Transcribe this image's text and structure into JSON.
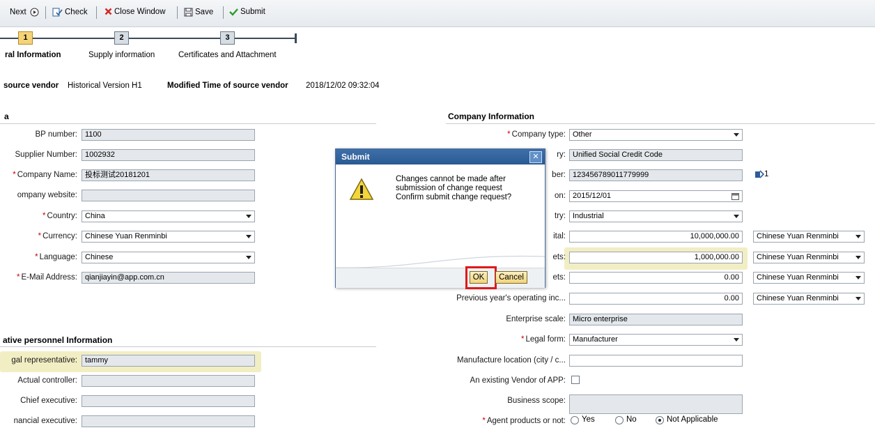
{
  "toolbar": {
    "next": "Next",
    "check": "Check",
    "close_window": "Close Window",
    "save": "Save",
    "submit": "Submit"
  },
  "steps": [
    {
      "num": "1",
      "label": "ral Information"
    },
    {
      "num": "2",
      "label": "Supply information"
    },
    {
      "num": "3",
      "label": "Certificates and Attachment"
    }
  ],
  "source_info": {
    "source_vendor_label": "source vendor",
    "source_vendor_value": "Historical Version H1",
    "modified_time_label": "Modified Time of source vendor",
    "modified_time_value": "2018/12/02 09:32:04"
  },
  "left_section": {
    "header": "a",
    "fields": [
      {
        "label": "BP number:",
        "value": "1100",
        "required": false
      },
      {
        "label": "Supplier Number:",
        "value": "1002932",
        "required": false
      },
      {
        "label": "Company Name:",
        "value": "投标测试20181201",
        "required": true
      },
      {
        "label": "ompany website:",
        "value": "",
        "required": false
      },
      {
        "label": "Country:",
        "value": "China",
        "required": true
      },
      {
        "label": "Currency:",
        "value": "Chinese Yuan Renminbi",
        "required": true
      },
      {
        "label": "Language:",
        "value": "Chinese",
        "required": true
      },
      {
        "label": "E-Mail Address:",
        "value": "qianjiayin@app.com.cn",
        "required": true
      }
    ]
  },
  "personnel_section": {
    "header": "ative personnel Information",
    "fields": [
      {
        "label": "gal representative:",
        "value": "tammy"
      },
      {
        "label": "Actual controller:",
        "value": ""
      },
      {
        "label": "Chief executive:",
        "value": ""
      },
      {
        "label": "nancial executive:",
        "value": ""
      }
    ]
  },
  "company_section": {
    "header": "Company Information",
    "company_type_label": "Company type:",
    "company_type_value": "Other",
    "id_type_label": "ry:",
    "id_type_value": "Unified Social Credit Code",
    "id_number_label": "ber:",
    "id_number_value": "123456789011779999",
    "id_attach_count": "1",
    "date_label": "on:",
    "date_value": "2015/12/01",
    "industry_label": "try:",
    "industry_value": "Industrial",
    "capital_label": "ital:",
    "capital_value": "10,000,000.00",
    "capital_currency": "Chinese Yuan Renminbi",
    "assets_label": "ets:",
    "assets_value": "1,000,000.00",
    "assets_currency": "Chinese Yuan Renminbi",
    "assets2_label": "ets:",
    "assets2_value": "0.00",
    "assets2_currency": "Chinese Yuan Renminbi",
    "prev_income_label": "Previous year's operating inc...",
    "prev_income_value": "0.00",
    "prev_income_currency": "Chinese Yuan Renminbi",
    "scale_label": "Enterprise scale:",
    "scale_value": "Micro enterprise",
    "legal_form_label": "Legal form:",
    "legal_form_value": "Manufacturer",
    "manufacture_loc_label": "Manufacture location (city / c...",
    "manufacture_loc_value": "",
    "existing_vendor_label": "An existing Vendor of APP:",
    "business_scope_label": "Business scope:",
    "agent_label": "Agent products or not:",
    "agent_options": [
      "Yes",
      "No",
      "Not Applicable"
    ],
    "agent_selected": "Not Applicable"
  },
  "dialog": {
    "title": "Submit",
    "close": "✕",
    "message_lines": [
      "Changes cannot be made after",
      "submission of change request",
      "Confirm submit change request?"
    ],
    "ok": "OK",
    "cancel": "Cancel"
  },
  "colors": {
    "accent_blue": "#2a5a93",
    "highlight": "#f2eec4",
    "annotation_red": "#e01818",
    "required": "#cc0000"
  }
}
